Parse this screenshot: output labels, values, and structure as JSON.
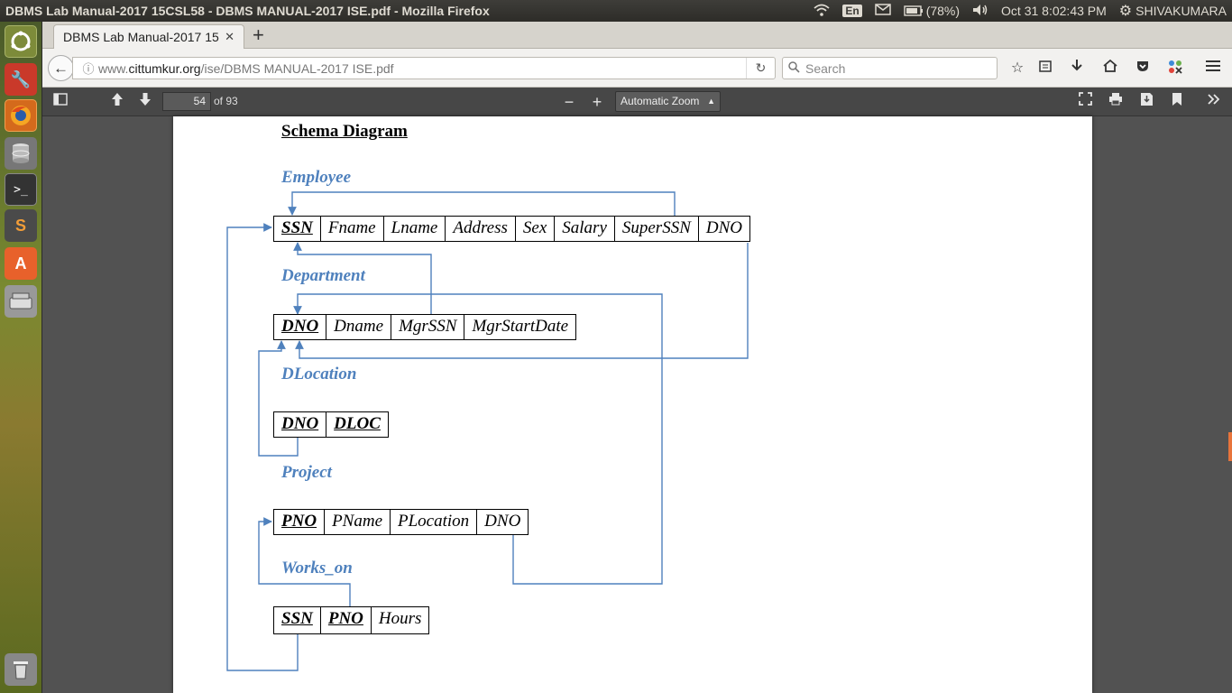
{
  "topbar": {
    "window_title": "DBMS Lab Manual-2017 15CSL58 - DBMS MANUAL-2017 ISE.pdf - Mozilla Firefox",
    "keyboard": "En",
    "battery": "(78%)",
    "datetime": "Oct 31  8:02:43 PM",
    "user": "SHIVAKUMARA"
  },
  "launcher": {
    "items": [
      "ubuntu-dash-icon",
      "system-settings-icon",
      "firefox-icon",
      "database-icon",
      "terminal-icon",
      "sublime-text-icon",
      "software-center-icon",
      "disk-icon",
      "trash-icon"
    ]
  },
  "browser": {
    "tab_title": "DBMS Lab Manual-2017 15",
    "url_prefix": "www.",
    "url_domain": "cittumkur.org",
    "url_path": "/ise/DBMS MANUAL-2017 ISE.pdf",
    "search_placeholder": "Search"
  },
  "pdf_toolbar": {
    "page_number": "54",
    "page_total": "of 93",
    "zoom": "Automatic Zoom"
  },
  "document": {
    "heading": "Schema Diagram",
    "entities": [
      {
        "name": "Employee",
        "attributes": [
          {
            "label": "SSN",
            "pk": true
          },
          {
            "label": "Fname",
            "pk": false
          },
          {
            "label": "Lname",
            "pk": false
          },
          {
            "label": "Address",
            "pk": false
          },
          {
            "label": "Sex",
            "pk": false
          },
          {
            "label": "Salary",
            "pk": false
          },
          {
            "label": "SuperSSN",
            "pk": false
          },
          {
            "label": "DNO",
            "pk": false
          }
        ]
      },
      {
        "name": "Department",
        "attributes": [
          {
            "label": "DNO",
            "pk": true
          },
          {
            "label": "Dname",
            "pk": false
          },
          {
            "label": "MgrSSN",
            "pk": false
          },
          {
            "label": "MgrStartDate",
            "pk": false
          }
        ]
      },
      {
        "name": "DLocation",
        "attributes": [
          {
            "label": "DNO",
            "pk": true
          },
          {
            "label": "DLOC",
            "pk": true
          }
        ]
      },
      {
        "name": "Project",
        "attributes": [
          {
            "label": "PNO",
            "pk": true
          },
          {
            "label": "PName",
            "pk": false
          },
          {
            "label": "PLocation",
            "pk": false
          },
          {
            "label": "DNO",
            "pk": false
          }
        ]
      },
      {
        "name": "Works_on",
        "attributes": [
          {
            "label": "SSN",
            "pk": true
          },
          {
            "label": "PNO",
            "pk": true
          },
          {
            "label": "Hours",
            "pk": false
          }
        ]
      }
    ]
  },
  "colors": {
    "entity_label": "#4f81bd",
    "arrow": "#4f81bd"
  }
}
